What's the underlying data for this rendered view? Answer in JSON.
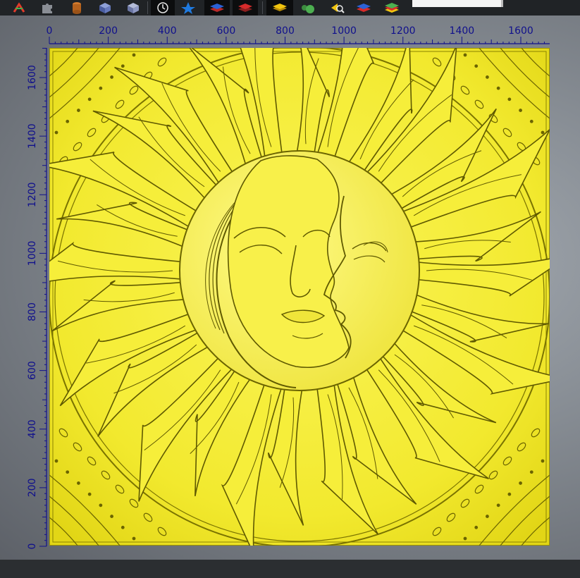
{
  "toolbar": {
    "buttons": [
      {
        "name": "vector-tool-icon",
        "color": "#e23b2a"
      },
      {
        "name": "puzzle-icon",
        "color": "#7b7f86"
      },
      {
        "name": "cylinder-icon",
        "color": "#b5621d"
      },
      {
        "name": "cube-blue-icon",
        "color": "#5a6dae"
      },
      {
        "name": "cube-shaded-icon",
        "color": "#7b86b8"
      },
      {
        "name": "clock-icon",
        "color": "#e8e8e8"
      },
      {
        "name": "star-layer-icon",
        "color": "#1f7ae0"
      },
      {
        "name": "layers-blue-icon",
        "color": "#2b62d6"
      },
      {
        "name": "layers-red-icon",
        "color": "#d62b2b"
      },
      {
        "name": "layer-yellow-icon",
        "color": "#f1c40f"
      },
      {
        "name": "relief-green-icon",
        "color": "#4caf50"
      },
      {
        "name": "zoom-search-icon",
        "color": "#f1c40f"
      },
      {
        "name": "layers-stack-icon",
        "color": "#2b62d6"
      },
      {
        "name": "layers-multicolor-icon",
        "color": "#4caf50"
      }
    ]
  },
  "ruler": {
    "x_ticks": [
      "0",
      "200",
      "400",
      "600",
      "800",
      "1000",
      "1200",
      "1400",
      "1600"
    ],
    "y_ticks": [
      "0",
      "200",
      "400",
      "600",
      "800",
      "1000",
      "1200",
      "1400",
      "1600"
    ],
    "color": "#10108c"
  },
  "relief": {
    "description_color": "#f4ec2a",
    "shadow_color": "#6b6400"
  }
}
